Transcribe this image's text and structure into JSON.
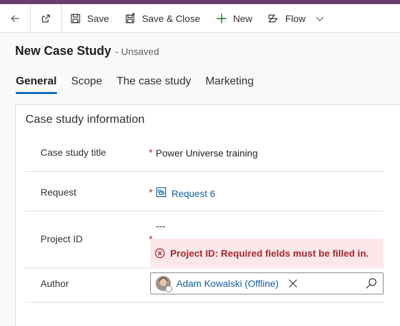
{
  "command_bar": {
    "save_label": "Save",
    "save_close_label": "Save & Close",
    "new_label": "New",
    "flow_label": "Flow"
  },
  "form": {
    "title": "New Case Study",
    "status": "- Unsaved"
  },
  "tabs": [
    {
      "label": "General",
      "active": true
    },
    {
      "label": "Scope"
    },
    {
      "label": "The case study"
    },
    {
      "label": "Marketing"
    }
  ],
  "section": {
    "title": "Case study information",
    "fields": {
      "title": {
        "label": "Case study title",
        "required": "*",
        "value": "Power Universe training"
      },
      "request": {
        "label": "Request",
        "required": "*",
        "value": "Request 6"
      },
      "project_id": {
        "label": "Project ID",
        "required": "*",
        "value": "---",
        "error": "Project ID: Required fields must be filled in."
      },
      "author": {
        "label": "Author",
        "value": "Adam Kowalski (Offline)"
      }
    }
  },
  "colors": {
    "accent": "#0f6cbd",
    "brand_strip": "#6b3d6e",
    "link": "#115ea3",
    "error_text": "#a4262c",
    "error_bg": "#fde7e9"
  }
}
